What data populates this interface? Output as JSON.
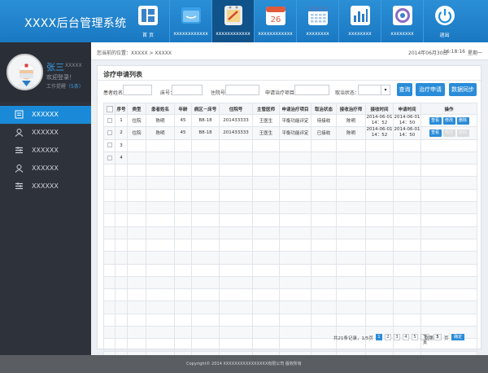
{
  "app": {
    "title": "XXXX后台管理系统"
  },
  "nav": [
    {
      "label": "首 页",
      "icon": "home-icon",
      "color": "#3a83c8"
    },
    {
      "label": "xxxxxxxxxxxx",
      "icon": "folder-icon",
      "color": "#3aa0e8"
    },
    {
      "label": "xxxxxxxxxxxx",
      "icon": "notepad-icon",
      "color": "#e8ecef",
      "active": true
    },
    {
      "label": "xxxxxxxxxxxx",
      "icon": "calendar-icon",
      "color": "#e05a3c"
    },
    {
      "label": "xxxxxxxx",
      "icon": "grid-calendar-icon",
      "color": "#3a83c8"
    },
    {
      "label": "xxxxxxxx",
      "icon": "bar-chart-icon",
      "color": "#2a7dc8"
    },
    {
      "label": "xxxxxxxx",
      "icon": "dial-icon",
      "color": "#3a83c8"
    },
    {
      "label": "退出",
      "icon": "power-icon",
      "color": "#1f8fe0"
    }
  ],
  "user": {
    "name": "张三",
    "id": "XXXXX",
    "welcome": "欢迎登录！",
    "remind_label": "工作提醒",
    "remind_count": "（5条）"
  },
  "sidebar": [
    {
      "label": "XXXXXX",
      "icon": "calendar-list-icon",
      "active": true
    },
    {
      "label": "XXXXXX",
      "icon": "user-icon"
    },
    {
      "label": "XXXXXX",
      "icon": "list-icon"
    },
    {
      "label": "XXXXXX",
      "icon": "user-icon"
    },
    {
      "label": "XXXXXX",
      "icon": "list-icon"
    }
  ],
  "breadcrumb": {
    "text": "您当前的位置：XXXXX > XXXXX",
    "date": "2014年06月30日",
    "time": "16:18:16",
    "weekday": "星期一"
  },
  "panel": {
    "title": "诊疗申请列表"
  },
  "filters": {
    "patient_name_label": "患者姓名：",
    "bed_label": "床号：",
    "admission_label": "住院号：",
    "project_label": "申请治疗项目：",
    "status_label": "取治状态：",
    "search_btn": "查询",
    "apply_btn": "治疗申请",
    "sync_btn": "数据同步"
  },
  "table": {
    "headers": [
      "",
      "序号",
      "类型",
      "患者姓名",
      "年龄",
      "病区－床号",
      "住院号",
      "主管医师",
      "申请治疗项目",
      "取治状态",
      "接收治疗师",
      "接收时间",
      "申请时间",
      "操作"
    ],
    "rows": [
      {
        "no": "1",
        "type": "住院",
        "name": "陈明",
        "age": "45",
        "bed": "B8-18",
        "admission": "201433333",
        "doctor": "王医生",
        "project": "平衡功能评定",
        "status": "待接收",
        "therapist": "陈明",
        "recv_date": "2014-06-01",
        "recv_time": "14：52",
        "apply_date": "2014-06-01",
        "apply_time": "14：50",
        "ops": [
          "查看",
          "修改",
          "删除"
        ],
        "ops_enabled": true
      },
      {
        "no": "2",
        "type": "住院",
        "name": "陈明",
        "age": "45",
        "bed": "B8-18",
        "admission": "201433333",
        "doctor": "王医生",
        "project": "平衡功能评定",
        "status": "已接收",
        "therapist": "陈明",
        "recv_date": "2014-06-01",
        "recv_time": "14：52",
        "apply_date": "2014-06-01",
        "apply_time": "14：50",
        "ops": [
          "查看",
          "修改",
          "删除"
        ],
        "ops_enabled": false
      },
      {
        "no": "3"
      },
      {
        "no": "4"
      }
    ]
  },
  "pager": {
    "summary": "共21条记录，1/5页",
    "pages": [
      "1",
      "2",
      "3",
      "4",
      "5"
    ],
    "next": "下页",
    "goto_label": "到第",
    "goto_value": "5",
    "goto_unit": "页",
    "goto_btn": "确定"
  },
  "footer": {
    "text": "Copyright© 2014 XXXXXXXXXXXXXXXX有限公司 版权所有"
  }
}
